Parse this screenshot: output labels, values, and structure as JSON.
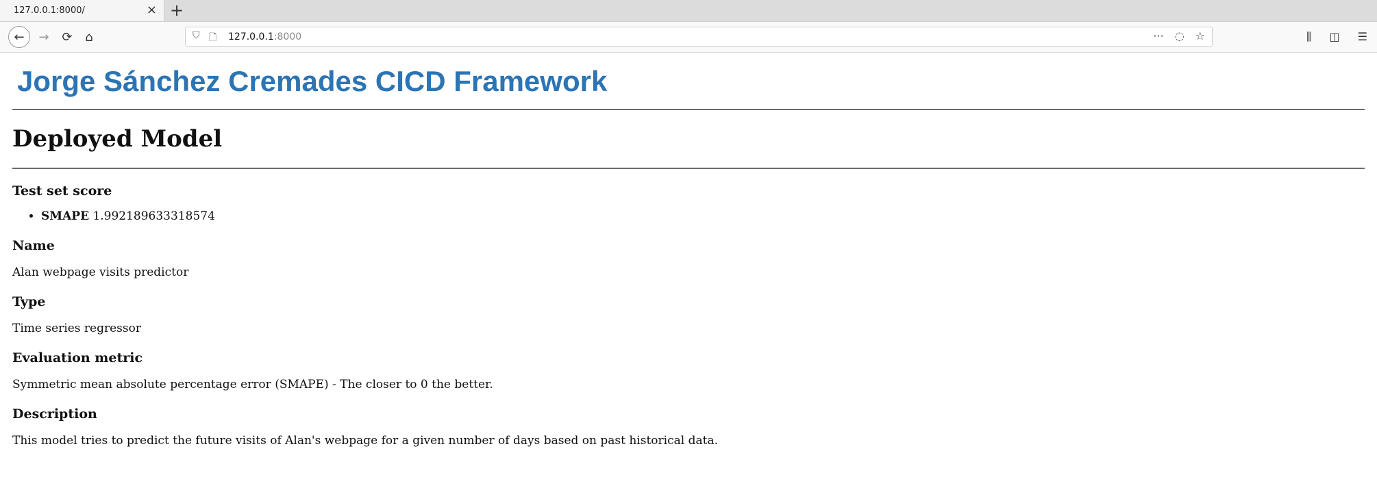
{
  "browser": {
    "tab_title": "127.0.0.1:8000/",
    "close_glyph": "×",
    "new_tab_glyph": "+",
    "url_host": "127.0.0.1",
    "url_port": ":8000",
    "icons": {
      "back": "←",
      "forward": "→",
      "reload": "⟳",
      "home": "⌂",
      "shield": "⛉",
      "page": "🗋",
      "more": "···",
      "pocket": "◌",
      "star": "☆",
      "library": "⫼",
      "sidebar": "◫",
      "menu": "☰"
    }
  },
  "page": {
    "brand": "Jorge Sánchez Cremades CICD Framework",
    "title": "Deployed Model",
    "score_heading": "Test set score",
    "score_label": "SMAPE",
    "score_value": "1.992189633318574",
    "name_heading": "Name",
    "name_value": "Alan webpage visits predictor",
    "type_heading": "Type",
    "type_value": "Time series regressor",
    "metric_heading": "Evaluation metric",
    "metric_value": "Symmetric mean absolute percentage error (SMAPE) - The closer to 0 the better.",
    "description_heading": "Description",
    "description_value": "This model tries to predict the future visits of Alan's webpage for a given number of days based on past historical data."
  },
  "colors": {
    "brand": "#2c74b4",
    "rule": "#6b6b6b"
  }
}
